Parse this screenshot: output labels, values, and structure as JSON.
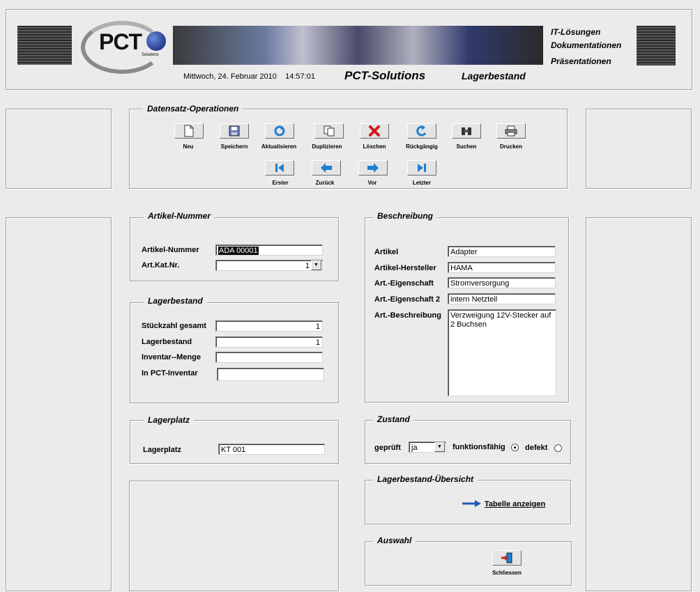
{
  "header": {
    "logo_text": "PCT",
    "logo_sub": "Solutions",
    "datetime": "Mittwoch, 24. Februar 2010    14:57:01",
    "company": "PCT-Solutions",
    "section": "Lagerbestand",
    "tagline": [
      "IT-Lösungen",
      "Dokumentationen",
      "Präsentationen"
    ]
  },
  "ops": {
    "title": "Datensatz-Operationen",
    "buttons": [
      {
        "label": "Neu",
        "icon": "new-document-icon"
      },
      {
        "label": "Speichern",
        "icon": "save-icon"
      },
      {
        "label": "Aktualisieren",
        "icon": "refresh-icon"
      },
      {
        "label": "Duplizieren",
        "icon": "duplicate-icon"
      },
      {
        "label": "Löschen",
        "icon": "delete-icon"
      },
      {
        "label": "Rückgängig",
        "icon": "undo-icon"
      },
      {
        "label": "Suchen",
        "icon": "binoculars-icon"
      },
      {
        "label": "Drucken",
        "icon": "printer-icon"
      }
    ],
    "nav": [
      {
        "label": "Erster",
        "icon": "first-record-icon"
      },
      {
        "label": "Zurück",
        "icon": "previous-record-icon"
      },
      {
        "label": "Vor",
        "icon": "next-record-icon"
      },
      {
        "label": "Letzter",
        "icon": "last-record-icon"
      }
    ]
  },
  "artikel": {
    "title": "Artikel-Nummer",
    "nummer_label": "Artikel-Nummer",
    "nummer_value": "ADA 00001",
    "katnr_label": "Art.Kat.Nr.",
    "katnr_value": "1"
  },
  "lager": {
    "title": "Lagerbestand",
    "stueck_label": "Stückzahl gesamt",
    "stueck_value": "1",
    "bestand_label": "Lagerbestand",
    "bestand_value": "1",
    "inventar_label": "Inventar--Menge",
    "inventar_value": "",
    "pct_label": "In PCT-Inventar",
    "pct_value": ""
  },
  "platz": {
    "title": "Lagerplatz",
    "label": "Lagerplatz",
    "value": "KT 001"
  },
  "beschreibung": {
    "title": "Beschreibung",
    "artikel_label": "Artikel",
    "artikel_value": "Adapter",
    "hersteller_label": "Artikel-Hersteller",
    "hersteller_value": "HAMA",
    "eig1_label": "Art.-Eigenschaft",
    "eig1_value": "Stromversorgung",
    "eig2_label": "Art.-Eigenschaft 2",
    "eig2_value": "intern Netzteil",
    "text_label": "Art.-Beschreibung",
    "text_value": "Verzweigung 12V-Stecker auf 2 Buchsen"
  },
  "zustand": {
    "title": "Zustand",
    "geprueft_label": "geprüft",
    "geprueft_value": "ja",
    "funktion_label": "funktionsfähig",
    "defekt_label": "defekt",
    "selected": "funktionsfähig"
  },
  "uebersicht": {
    "title": "Lagerbestand-Übersicht",
    "link": "Tabelle anzeigen"
  },
  "auswahl": {
    "title": "Auswahl",
    "close_label": "Schliessen"
  },
  "colors": {
    "accent_blue": "#1f5fb0",
    "delete_red": "#d21a1a",
    "background": "#ebebeb"
  }
}
